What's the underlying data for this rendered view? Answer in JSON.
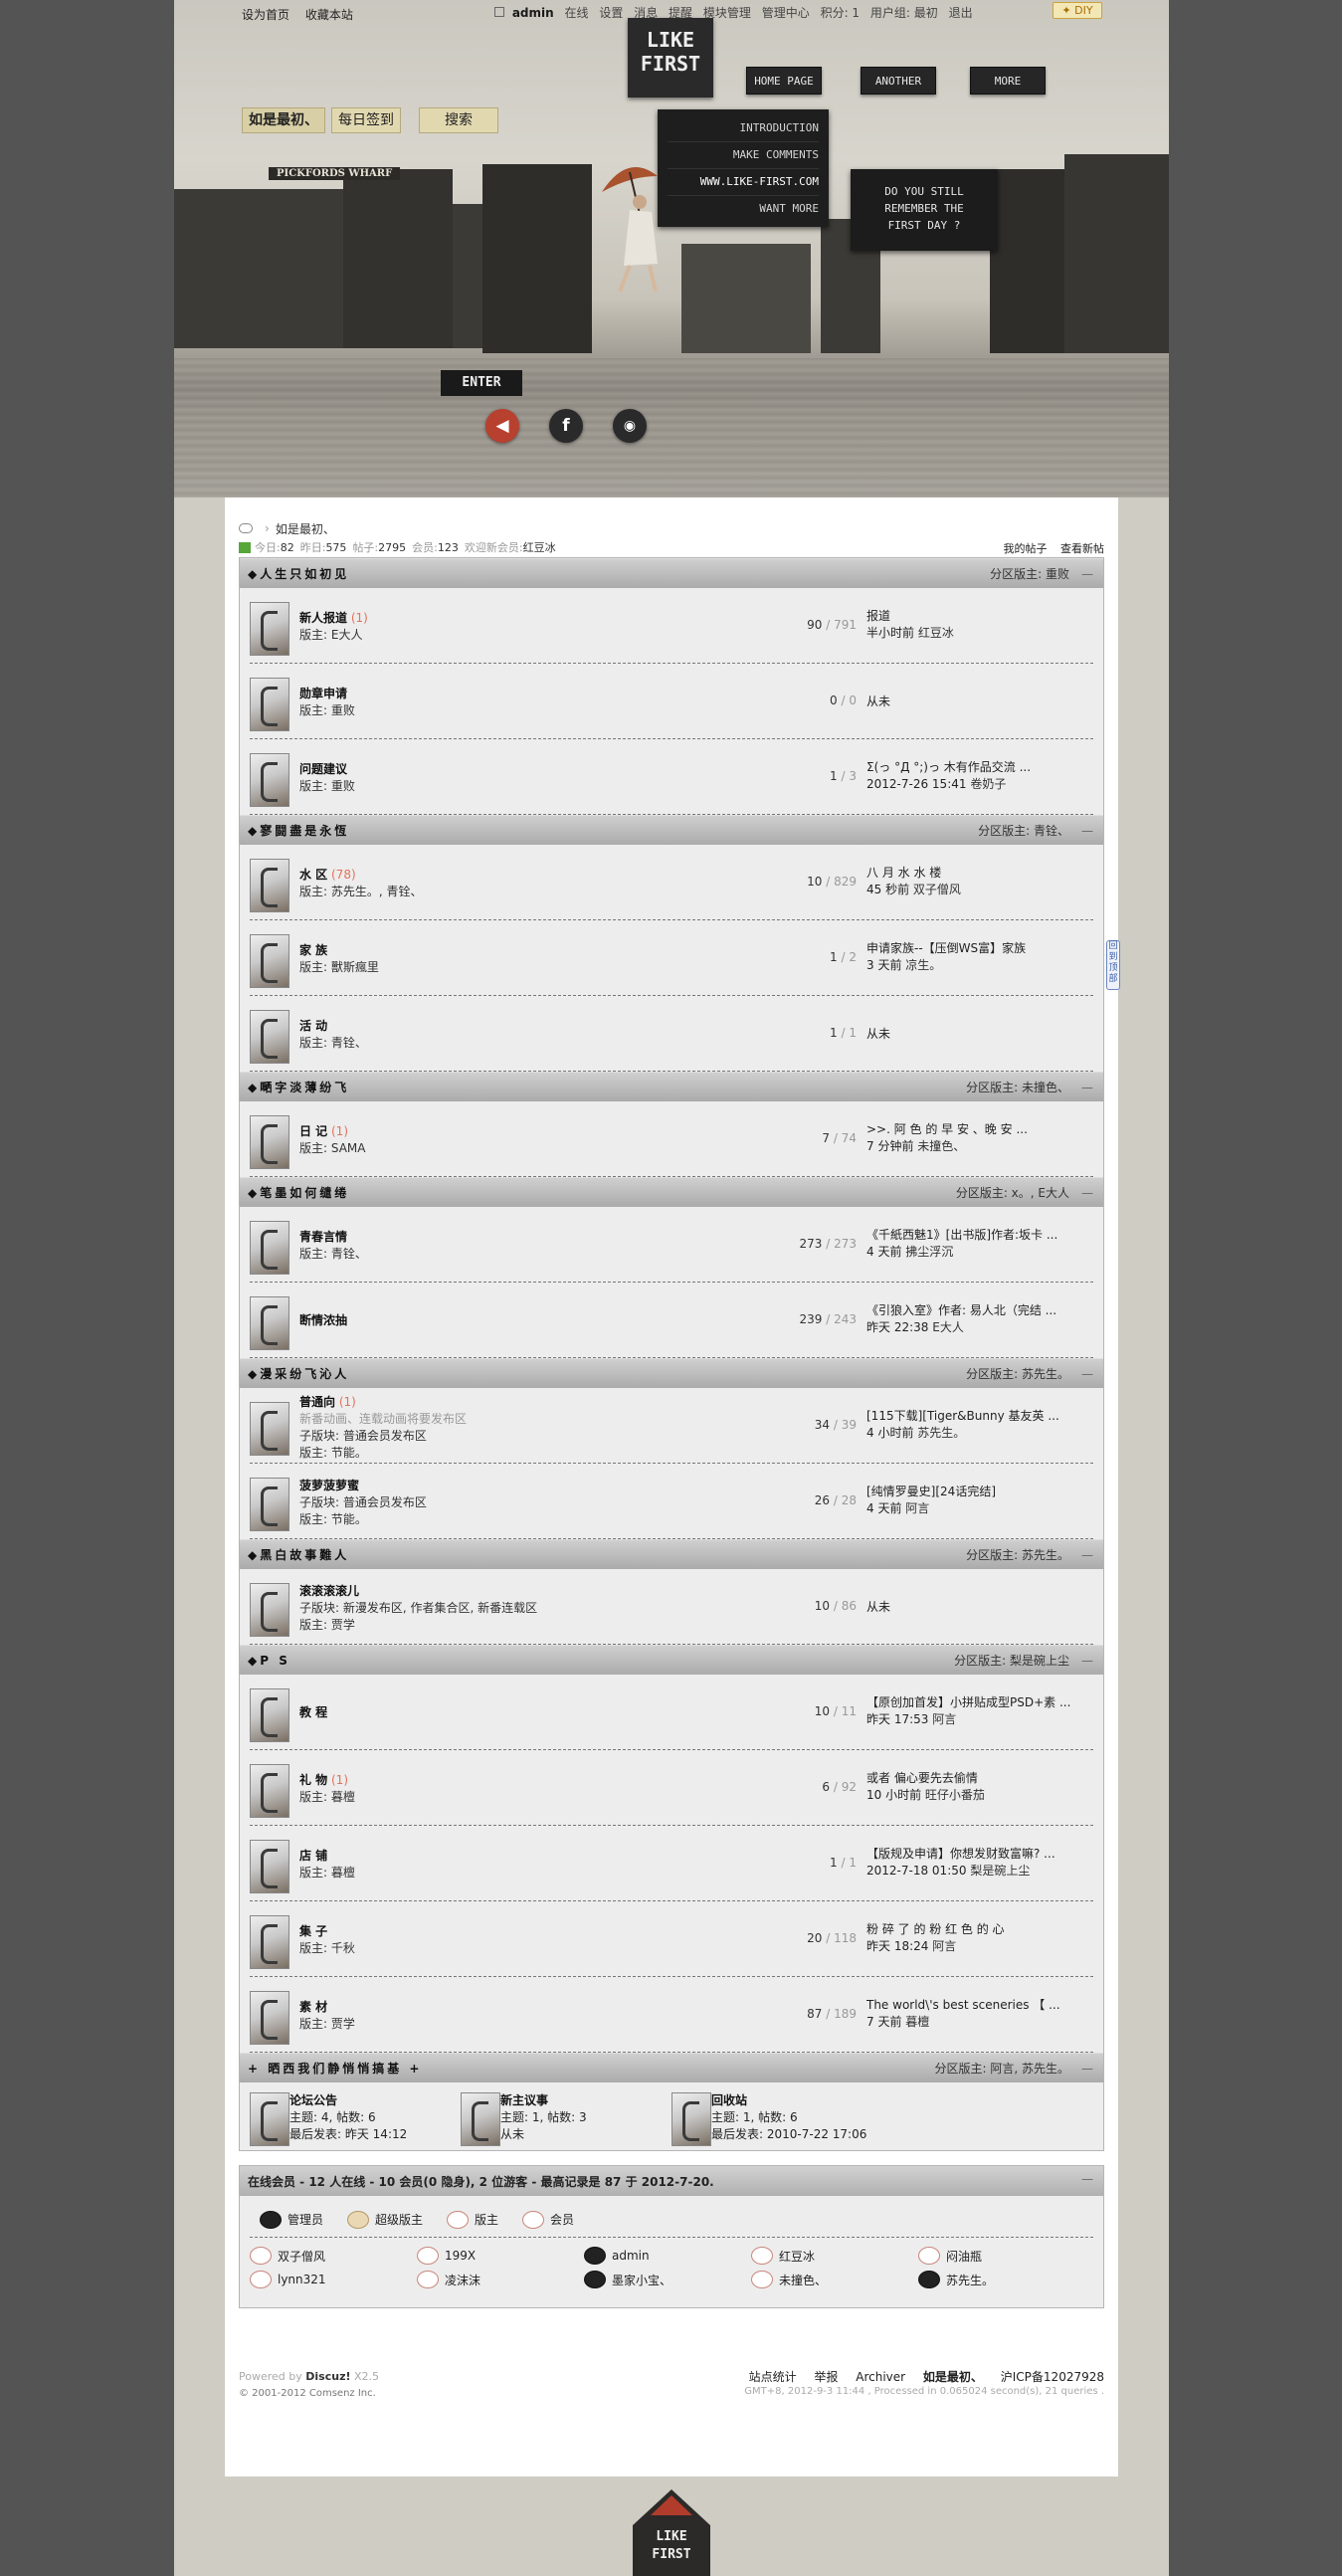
{
  "topbar": {
    "links": [
      "设为首页",
      "收藏本站"
    ],
    "user": "admin",
    "usernav": [
      "在线",
      "设置",
      "消息",
      "提醒",
      "模块管理",
      "管理中心",
      "积分: 1",
      "用户组: 最初",
      "退出"
    ],
    "diy": "DIY"
  },
  "logo": {
    "line1": "LIKE",
    "line2": "FIRST"
  },
  "nav": [
    "HOME PAGE",
    "ANOTHER",
    "MORE"
  ],
  "quick": [
    "如是最初、",
    "每日签到",
    "搜索"
  ],
  "sign": "PICKFORDS WHARF",
  "dropmenu": [
    "INTRODUCTION",
    "MAKE COMMENTS",
    "WWW.LIKE-FIRST.COM",
    "WANT MORE"
  ],
  "bubble": {
    "l1": "DO YOU STILL",
    "l2": "REMEMBER THE",
    "l3": "FIRST DAY ?"
  },
  "enter": "ENTER",
  "social_icons": [
    "back-icon",
    "facebook-icon",
    "weibo-icon"
  ],
  "crumb": {
    "home": "如是最初、"
  },
  "stats": {
    "today_label": "今日:",
    "today": "82",
    "yest_label": "昨日:",
    "yest": "575",
    "posts_label": "帖子:",
    "posts": "2795",
    "members_label": "会员:",
    "members": "123",
    "welcome_label": "欢迎新会员:",
    "welcome": "红豆冰",
    "my_posts": "我的帖子",
    "new_posts": "查看新帖"
  },
  "categories": [
    {
      "title": "人生只如初见",
      "mods": "分区版主: 重败",
      "forums": [
        {
          "name": "新人报道",
          "new": " (1)",
          "mod": "版主: E大人",
          "threads": "90",
          "posts": "791",
          "last_title": "报道",
          "last_time": "半小时前",
          "last_by": "红豆冰"
        },
        {
          "name": "勋章申请",
          "new": "",
          "mod": "版主: 重败",
          "threads": "0",
          "posts": "0",
          "last_title": "从未",
          "last_time": "",
          "last_by": ""
        },
        {
          "name": "问题建议",
          "new": "",
          "mod": "版主: 重败",
          "threads": "1",
          "posts": "3",
          "last_title": "Σ(っ °Д °;)っ 木有作品交流 ...",
          "last_time": "2012-7-26 15:41",
          "last_by": "卷奶子"
        }
      ]
    },
    {
      "title": "寥闘盡是永恆",
      "mods": "分区版主: 青铨、",
      "forums": [
        {
          "name": "水 区",
          "new": " (78)",
          "mod": "版主: 苏先生。, 青铨、",
          "threads": "10",
          "posts": "829",
          "last_title": "八 月 水 水 楼",
          "last_time": "45 秒前",
          "last_by": "双子僧风"
        },
        {
          "name": "家 族",
          "new": "",
          "mod": "版主: 獸斯瘋里",
          "threads": "1",
          "posts": "2",
          "last_title": "申请家族--【压倒WS富】家族",
          "last_time": "3 天前",
          "last_by": "凉生。"
        },
        {
          "name": "活 动",
          "new": "",
          "mod": "版主: 青铨、",
          "threads": "1",
          "posts": "1",
          "last_title": "从未",
          "last_time": "",
          "last_by": ""
        }
      ]
    },
    {
      "title": "嗮字淡薄纷飞",
      "mods": "分区版主: 未撞色、",
      "forums": [
        {
          "name": "日 记",
          "new": " (1)",
          "mod": "版主: SAMA",
          "threads": "7",
          "posts": "74",
          "last_title": ">>. 阿 色 的 早 安 、晚 安 ...",
          "last_time": "7 分钟前",
          "last_by": "未撞色、"
        }
      ]
    },
    {
      "title": "笔墨如何缱绻",
      "mods": "分区版主: x。, E大人",
      "forums": [
        {
          "name": "青春言情",
          "new": "",
          "mod": "版主: 青铨、",
          "threads": "273",
          "posts": "273",
          "last_title": "《千紙西魅1》[出书版]作者:坂卡 ...",
          "last_time": "4 天前",
          "last_by": "拂尘浮沉"
        },
        {
          "name": "断情浓抽",
          "new": "",
          "mod": "",
          "threads": "239",
          "posts": "243",
          "last_title": "《引狼入室》作者: 易人北（完结 ...",
          "last_time": "昨天 22:38",
          "last_by": "E大人"
        }
      ]
    },
    {
      "title": "漫采纷飞沁人",
      "mods": "分区版主: 苏先生。",
      "forums": [
        {
          "name": "普通向",
          "new": " (1)",
          "desc": "新番动画、连载动画将要发布区",
          "sub": "子版块: 普通会员发布区",
          "mod": "版主: 节能。",
          "threads": "34",
          "posts": "39",
          "last_title": "[115下载][Tiger&Bunny 基友英 ...",
          "last_time": "4 小时前",
          "last_by": "苏先生。"
        },
        {
          "name": "菠萝菠萝蜜",
          "new": "",
          "sub": "子版块: 普通会员发布区",
          "mod": "版主: 节能。",
          "threads": "26",
          "posts": "28",
          "last_title": "[纯情罗曼史][24话完结]",
          "last_time": "4 天前",
          "last_by": "阿言"
        }
      ]
    },
    {
      "title": "黑白故事難人",
      "mods": "分区版主: 苏先生。",
      "forums": [
        {
          "name": "滚滚滚滚儿",
          "new": "",
          "sub": "子版块: 新漫发布区, 作者集合区, 新番连载区",
          "mod": "版主: 贾学",
          "threads": "10",
          "posts": "86",
          "last_title": "从未",
          "last_time": "",
          "last_by": ""
        }
      ]
    },
    {
      "title": "P S",
      "mods": "分区版主: 梨是碗上尘",
      "forums": [
        {
          "name": "教 程",
          "new": "",
          "mod": "",
          "threads": "10",
          "posts": "11",
          "last_title": "【原创加首发】小拼贴成型PSD+素 ...",
          "last_time": "昨天 17:53",
          "last_by": "阿言"
        },
        {
          "name": "礼 物",
          "new": " (1)",
          "mod": "版主: 暮檀",
          "threads": "6",
          "posts": "92",
          "last_title": "或者 偏心要先去偷情",
          "last_time": "10 小时前",
          "last_by": "旺仔小番茄"
        },
        {
          "name": "店 铺",
          "new": "",
          "mod": "版主: 暮檀",
          "threads": "1",
          "posts": "1",
          "last_title": "【版规及申请】你想发财致富嘛? ...",
          "last_time": "2012-7-18 01:50",
          "last_by": "梨是碗上尘"
        },
        {
          "name": "集 子",
          "new": "",
          "mod": "版主: 千秋",
          "threads": "20",
          "posts": "118",
          "last_title": "粉 碎 了 的 粉 红 色 的 心",
          "last_time": "昨天 18:24",
          "last_by": "阿言"
        },
        {
          "name": "素 材",
          "new": "",
          "mod": "版主: 贾学",
          "threads": "87",
          "posts": "189",
          "last_title": "The world\\'s best sceneries 【 ...",
          "last_time": "7 天前",
          "last_by": "暮檀"
        }
      ]
    }
  ],
  "lastcat": {
    "title": "+ 晒西我们静悄悄搞基 +",
    "mods": "分区版主: 阿言, 苏先生。",
    "items": [
      {
        "name": "论坛公告",
        "stat": "主题: 4, 帖数: 6",
        "last": "最后发表: 昨天 14:12"
      },
      {
        "name": "新主议事",
        "stat": "主题: 1, 帖数: 3",
        "last": "从未"
      },
      {
        "name": "回收站",
        "stat": "主题: 1, 帖数: 6",
        "last": "最后发表: 2010-7-22 17:06"
      }
    ]
  },
  "online": {
    "title": "在线会员 - 12 人在线 - 10 会员(0 隐身), 2 位游客 - 最高记录是 87 于 2012-7-20.",
    "legend": [
      "管理员",
      "超级版主",
      "版主",
      "会员"
    ],
    "users": [
      "双子僧风",
      "199X",
      "admin",
      "红豆冰",
      "闷油瓶",
      "lynn321",
      "凌沫沫",
      "墨家小宝、",
      "未撞色、",
      "苏先生。"
    ]
  },
  "footer": {
    "powered": "Powered by",
    "brand": "Discuz!",
    "ver": "X2.5",
    "copy": "© 2001-2012 Comsenz Inc.",
    "links": [
      "站点统计",
      "举报",
      "Archiver",
      "如是最初、",
      "沪ICP备12027928"
    ],
    "info": "GMT+8, 2012-9-3 11:44 , Processed in 0.065024 second(s), 21 queries ."
  },
  "sidebtn": "回到顶部",
  "colors": {
    "accent_new": "#e2725b",
    "cat_bar": "#b5b5b5",
    "page_bg": "#545454"
  }
}
